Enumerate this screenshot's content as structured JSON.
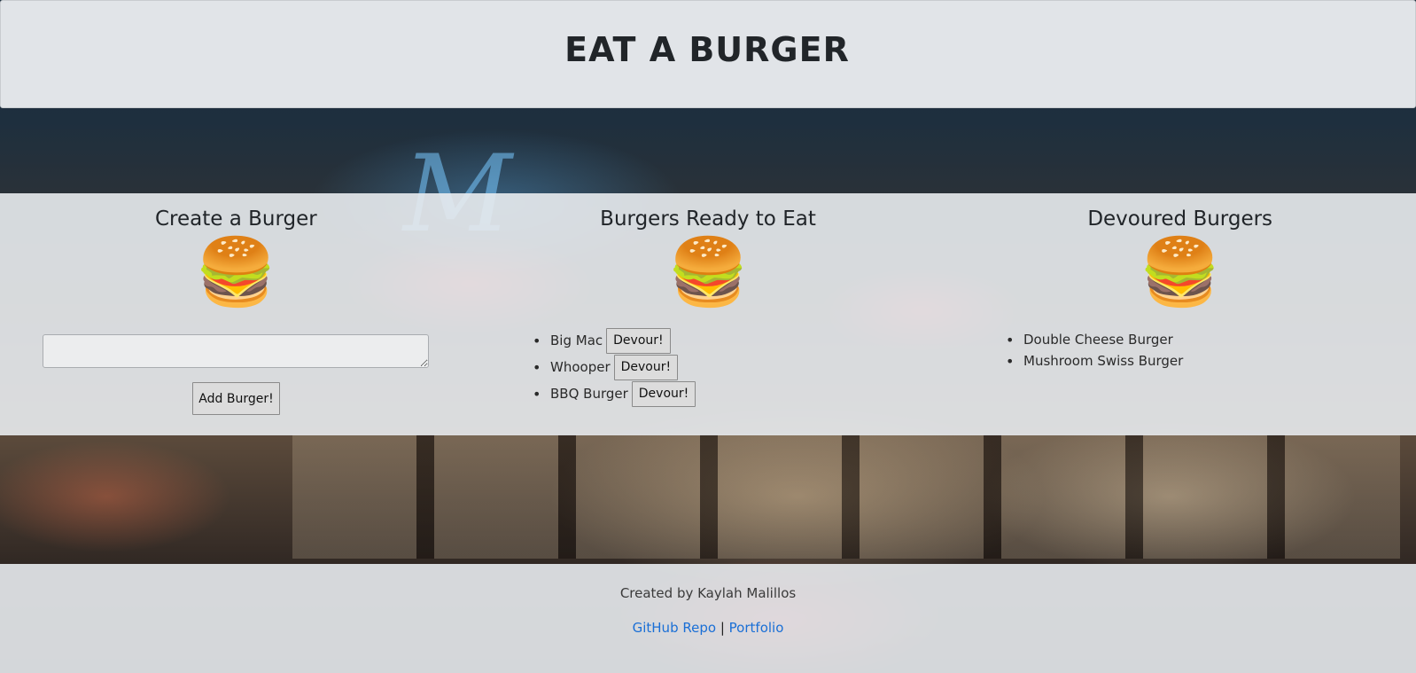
{
  "header": {
    "title": "EAT A BURGER"
  },
  "create": {
    "heading": "Create a Burger",
    "icon": "burger-icon",
    "input_value": "",
    "button_label": "Add Burger!"
  },
  "ready": {
    "heading": "Burgers Ready to Eat",
    "icon": "burger-icon",
    "items": [
      {
        "name": "Big Mac",
        "button_label": "Devour!"
      },
      {
        "name": "Whooper",
        "button_label": "Devour!"
      },
      {
        "name": "BBQ Burger",
        "button_label": "Devour!"
      }
    ]
  },
  "devoured": {
    "heading": "Devoured Burgers",
    "icon": "burger-icon",
    "items": [
      "Double Cheese Burger",
      "Mushroom Swiss Burger"
    ]
  },
  "footer": {
    "credit": "Created by Kaylah Malillos",
    "link_repo": "GitHub Repo",
    "separator": "|",
    "link_portfolio": "Portfolio"
  },
  "colors": {
    "link": "#1a6fd6",
    "panel": "#e9ecef",
    "text": "#212529"
  }
}
